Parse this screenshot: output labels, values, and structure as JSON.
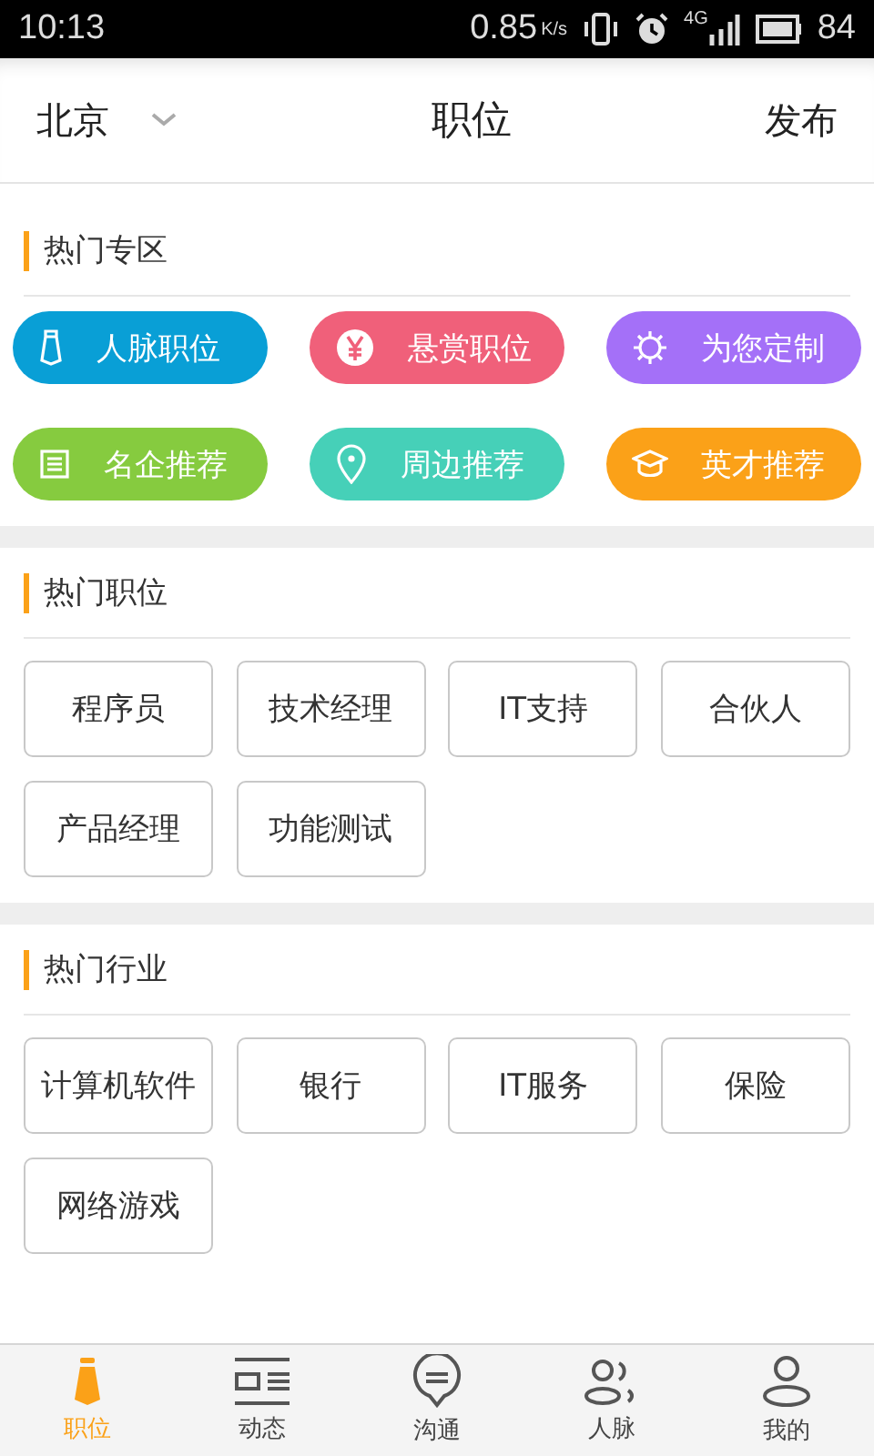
{
  "status_bar": {
    "time": "10:13",
    "speed": "0.85",
    "speed_unit": "K/s",
    "network": "4G",
    "battery": "84"
  },
  "header": {
    "city": "北京",
    "title": "职位",
    "action": "发布"
  },
  "hot_zone": {
    "title": "热门专区",
    "items": [
      {
        "label": "人脉职位",
        "color": "#099fd6"
      },
      {
        "label": "悬赏职位",
        "color": "#f0607a"
      },
      {
        "label": "为您定制",
        "color": "#a470f8"
      },
      {
        "label": "名企推荐",
        "color": "#86cb3f"
      },
      {
        "label": "周边推荐",
        "color": "#46d0b8"
      },
      {
        "label": "英才推荐",
        "color": "#fba118"
      }
    ]
  },
  "sections": [
    {
      "title": "热门职位",
      "tags": [
        "程序员",
        "技术经理",
        "IT支持",
        "合伙人",
        "产品经理",
        "功能测试"
      ]
    },
    {
      "title": "热门行业",
      "tags": [
        "计算机软件",
        "银行",
        "IT服务",
        "保险",
        "网络游戏"
      ]
    }
  ],
  "tabs": [
    {
      "label": "职位",
      "selected": true
    },
    {
      "label": "动态",
      "selected": false
    },
    {
      "label": "沟通",
      "selected": false
    },
    {
      "label": "人脉",
      "selected": false
    },
    {
      "label": "我的",
      "selected": false
    }
  ]
}
